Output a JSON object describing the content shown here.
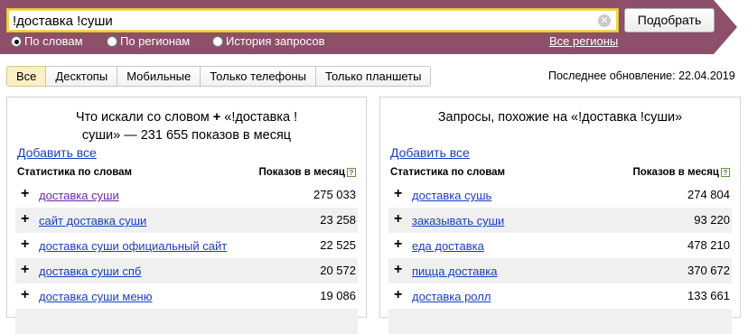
{
  "search": {
    "value": "!доставка !суши",
    "button_label": "Подобрать"
  },
  "modes": [
    {
      "label": "По словам",
      "selected": true
    },
    {
      "label": "По регионам",
      "selected": false
    },
    {
      "label": "История запросов",
      "selected": false
    }
  ],
  "regions_link": "Все регионы",
  "tabs": [
    "Все",
    "Десктопы",
    "Мобильные",
    "Только телефоны",
    "Только планшеты"
  ],
  "last_update": "Последнее обновление: 22.04.2019",
  "left_panel": {
    "title_line1": "Что искали со словом",
    "title_plus": "+",
    "title_query": "«!доставка !",
    "title_line2": "суши» — 231 655 показов в месяц",
    "add_all": "Добавить все",
    "col_keyword": "Статистика по словам",
    "col_count": "Показов в месяц",
    "rows": [
      {
        "keyword": "доставка суши",
        "count": "275 033"
      },
      {
        "keyword": "сайт доставка суши",
        "count": "23 258"
      },
      {
        "keyword": "доставка суши официальный сайт",
        "count": "22 525"
      },
      {
        "keyword": "доставка суши спб",
        "count": "20 572"
      },
      {
        "keyword": "доставка суши меню",
        "count": "19 086"
      }
    ]
  },
  "right_panel": {
    "title": "Запросы, похожие на «!доставка !суши»",
    "add_all": "Добавить все",
    "col_keyword": "Статистика по словам",
    "col_count": "Показов в месяц",
    "rows": [
      {
        "keyword": "доставка сушь",
        "count": "274 804"
      },
      {
        "keyword": "заказывать суши",
        "count": "93 220"
      },
      {
        "keyword": "еда доставка",
        "count": "478 210"
      },
      {
        "keyword": "пицца доставка",
        "count": "370 672"
      },
      {
        "keyword": "доставка ролл",
        "count": "133 661"
      }
    ]
  },
  "help_glyph": "?",
  "colors": {
    "band": "#8e4f6a",
    "link": "#1a3dc1",
    "active_tab": "#fbefc6"
  }
}
